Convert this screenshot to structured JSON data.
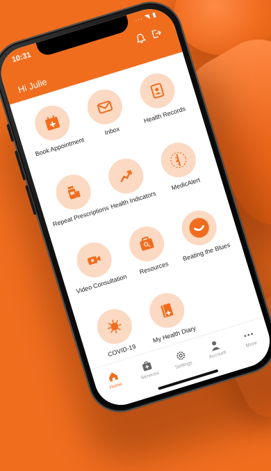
{
  "status": {
    "time": "10:31",
    "signal_icons": "··· ◥ ▮"
  },
  "header": {
    "greeting": "Hi Julie"
  },
  "tiles": [
    {
      "label": "Book Appointment",
      "icon": "calendar-add-icon"
    },
    {
      "label": "Inbox",
      "icon": "mail-icon"
    },
    {
      "label": "Health Records",
      "icon": "contact-card-icon"
    },
    {
      "label": "Repeat Prescriptions",
      "icon": "pill-bottles-icon"
    },
    {
      "label": "Health Indicators",
      "icon": "trend-up-icon"
    },
    {
      "label": "MedicAlert",
      "icon": "caduceus-icon"
    },
    {
      "label": "Video Consultation",
      "icon": "video-camera-icon"
    },
    {
      "label": "Resources",
      "icon": "resource-folder-icon"
    },
    {
      "label": "Beating the Blues",
      "icon": "smile-icon"
    },
    {
      "label": "COVID-19",
      "icon": "virus-icon"
    },
    {
      "label": "My Health Diary",
      "icon": "diary-icon"
    }
  ],
  "tabbar": [
    {
      "label": "Home",
      "icon": "home-icon",
      "active": true
    },
    {
      "label": "Services",
      "icon": "medical-bag-icon",
      "active": false
    },
    {
      "label": "Settings",
      "icon": "gear-icon",
      "active": false
    },
    {
      "label": "Account",
      "icon": "person-icon",
      "active": false
    },
    {
      "label": "More",
      "icon": "more-dots-icon",
      "active": false
    }
  ],
  "colors": {
    "accent": "#f06d1e",
    "tile_bg": "#fbd9c2"
  }
}
